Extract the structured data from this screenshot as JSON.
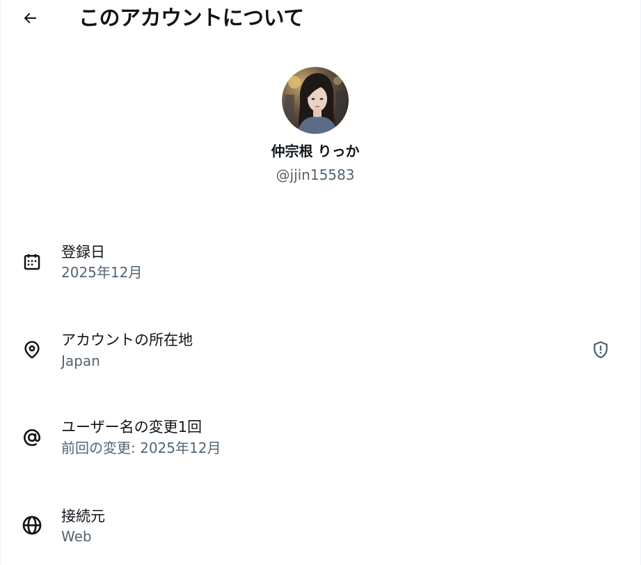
{
  "header": {
    "title": "このアカウントについて",
    "back_icon": "arrow-left-icon"
  },
  "profile": {
    "display_name": "仲宗根 りっか",
    "handle": "@jjin15583",
    "avatar_icon": "avatar-photo"
  },
  "rows": [
    {
      "icon": "calendar-icon",
      "title": "登録日",
      "value": "2025年12月"
    },
    {
      "icon": "location-pin-icon",
      "title": "アカウントの所在地",
      "value": "Japan",
      "trailing_icon": "shield-alert-icon"
    },
    {
      "icon": "at-sign-icon",
      "title": "ユーザー名の変更1回",
      "value": "前回の変更: 2025年12月"
    },
    {
      "icon": "globe-icon",
      "title": "接続元",
      "value": "Web"
    }
  ],
  "colors": {
    "text_primary": "#0f1419",
    "text_secondary": "#536471",
    "divider": "#eff3f4",
    "background": "#ffffff"
  }
}
